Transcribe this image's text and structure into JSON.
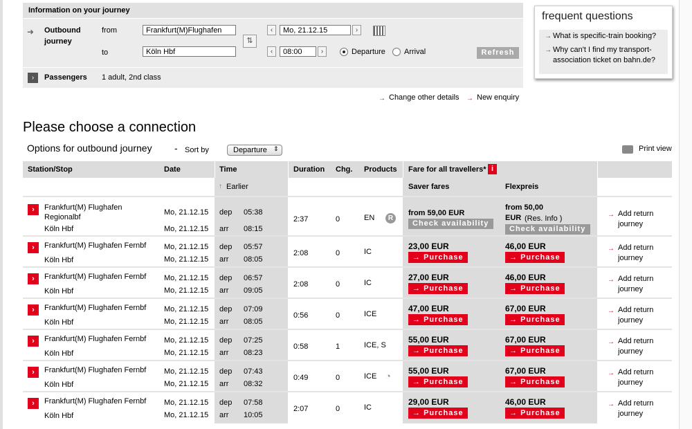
{
  "journey": {
    "title": "Information on your journey",
    "outbound_label_1": "Outbound",
    "outbound_label_2": "journey",
    "from_label": "from",
    "to_label": "to",
    "from_value": "Frankfurt(M)Flughafen",
    "to_value": "Köln Hbf",
    "date_value": "Mo, 21.12.15",
    "time_value": "08:00",
    "departure_label": "Departure",
    "arrival_label": "Arrival",
    "refresh_label": "Refresh",
    "passengers_label": "Passengers",
    "passengers_value": "1 adult, 2nd class"
  },
  "links": {
    "change_details": "Change other details",
    "new_enquiry": "New enquiry",
    "print_view": "Print view"
  },
  "faq": {
    "title": "frequent questions",
    "q1": "What is specific-train booking?",
    "q2a": "Why can't I find my transport-",
    "q2b": "association ticket on bahn.de?"
  },
  "page": {
    "heading": "Please choose a connection",
    "subheading": "Options for outbound journey",
    "dash": "-",
    "sort_label": "Sort by",
    "sort_value": "Departure"
  },
  "table": {
    "headers": {
      "station": "Station/Stop",
      "date": "Date",
      "time": "Time",
      "duration": "Duration",
      "changes": "Chg.",
      "products": "Products",
      "fare": "Fare for all travellers*",
      "earlier": "Earlier",
      "saver": "Saver fares",
      "flex": "Flexpreis"
    },
    "dep_label": "dep",
    "arr_label": "arr",
    "purchase_label": "Purchase",
    "check_label": "Check availability",
    "return_1": "Add return",
    "return_2": "journey",
    "rows": [
      {
        "from1": "Frankfurt(M) Flughafen",
        "from2": "Regionalbf",
        "to": "Köln Hbf",
        "date_dep": "Mo, 21.12.15",
        "date_arr": "Mo, 21.12.15",
        "dep": "05:38",
        "arr": "08:15",
        "duration": "2:37",
        "changes": "0",
        "products": "EN",
        "saver": "from 59,00 EUR",
        "flex1": "from 50,00",
        "flex2": "EUR",
        "flex_note": "(Res. Info )"
      },
      {
        "from1": "Frankfurt(M) Flughafen Fernbf",
        "to": "Köln Hbf",
        "date_dep": "Mo, 21.12.15",
        "date_arr": "Mo, 21.12.15",
        "dep": "05:57",
        "arr": "08:05",
        "duration": "2:08",
        "changes": "0",
        "products": "IC",
        "saver": "23,00 EUR",
        "flex": "46,00 EUR"
      },
      {
        "from1": "Frankfurt(M) Flughafen Fernbf",
        "to": "Köln Hbf",
        "date_dep": "Mo, 21.12.15",
        "date_arr": "Mo, 21.12.15",
        "dep": "06:57",
        "arr": "09:05",
        "duration": "2:08",
        "changes": "0",
        "products": "IC",
        "saver": "27,00 EUR",
        "flex": "46,00 EUR"
      },
      {
        "from1": "Frankfurt(M) Flughafen Fernbf",
        "to": "Köln Hbf",
        "date_dep": "Mo, 21.12.15",
        "date_arr": "Mo, 21.12.15",
        "dep": "07:09",
        "arr": "08:05",
        "duration": "0:56",
        "changes": "0",
        "products": "ICE",
        "saver": "47,00 EUR",
        "flex": "67,00 EUR"
      },
      {
        "from1": "Frankfurt(M) Flughafen Fernbf",
        "to": "Köln Hbf",
        "date_dep": "Mo, 21.12.15",
        "date_arr": "Mo, 21.12.15",
        "dep": "07:25",
        "arr": "08:23",
        "duration": "0:58",
        "changes": "1",
        "products": "ICE, S",
        "saver": "55,00 EUR",
        "flex": "67,00 EUR"
      },
      {
        "from1": "Frankfurt(M) Flughafen Fernbf",
        "to": "Köln Hbf",
        "date_dep": "Mo, 21.12.15",
        "date_arr": "Mo, 21.12.15",
        "dep": "07:43",
        "arr": "08:32",
        "duration": "0:49",
        "changes": "0",
        "products": "ICE",
        "saver": "55,00 EUR",
        "flex": "67,00 EUR"
      },
      {
        "from1": "Frankfurt(M) Flughafen Fernbf",
        "to": "Köln Hbf",
        "date_dep": "Mo, 21.12.15",
        "date_arr": "Mo, 21.12.15",
        "dep": "07:58",
        "arr": "10:05",
        "duration": "2:07",
        "changes": "0",
        "products": "IC",
        "saver": "29,00 EUR",
        "flex": "46,00 EUR"
      }
    ]
  },
  "colors": {
    "accent_red": "#e2001a",
    "panel_grey": "#ececec",
    "header_grey": "#dcdcdc"
  }
}
